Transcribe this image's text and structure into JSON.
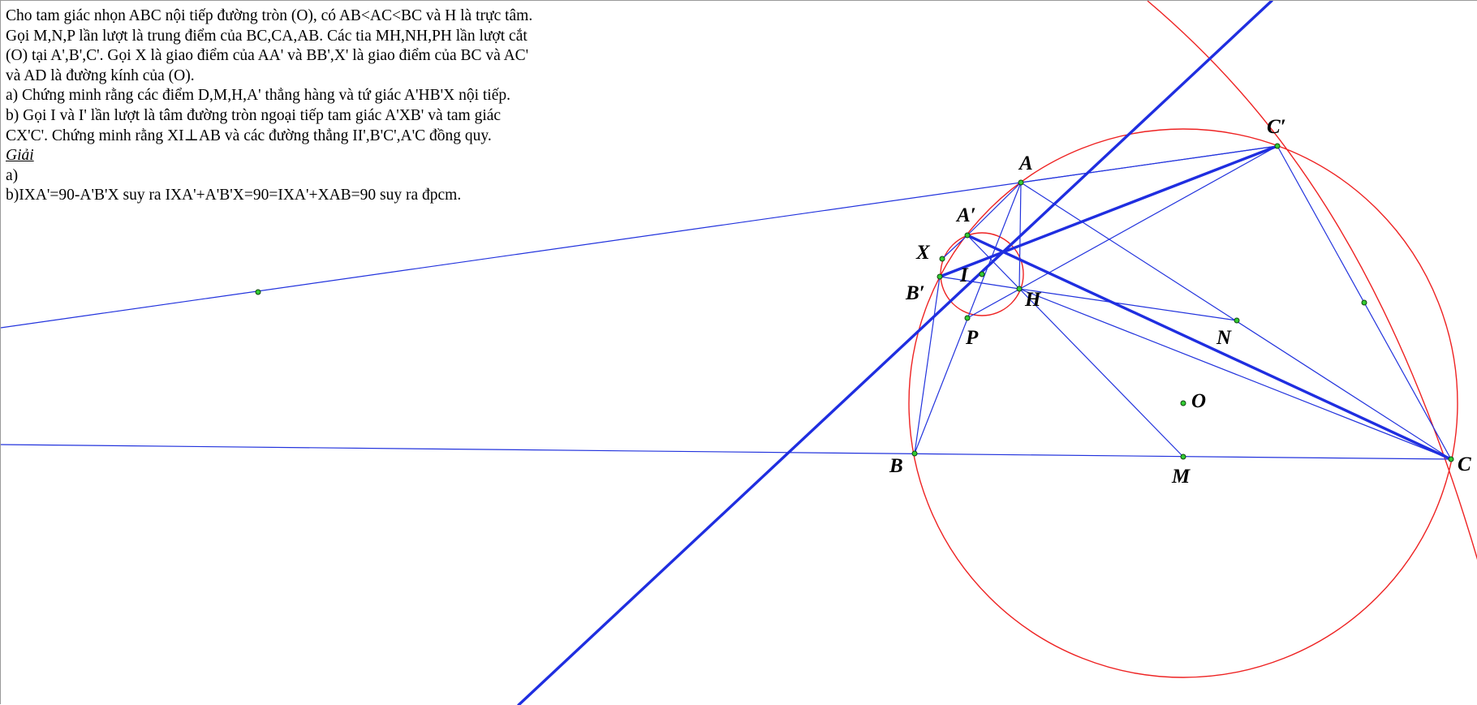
{
  "problem": {
    "lines": [
      "Cho tam giác nhọn ABC nội tiếp đường tròn (O), có AB<AC<BC và H là trực tâm.",
      "Gọi M,N,P lần lượt là trung điểm của BC,CA,AB. Các tia MH,NH,PH lần lượt cắt",
      "(O) tại A',B',C'. Gọi X là giao điểm của AA' và BB',X' là giao điểm của BC và AC'",
      "và AD là đường kính của (O).",
      "a) Chứng minh rằng các điểm D,M,H,A' thẳng hàng và tứ giác A'HB'X nội tiếp.",
      "b) Gọi I và I' lần lượt là tâm đường tròn ngoại tiếp tam giác A'XB' và tam giác",
      "CX'C'. Chứng minh rằng XI⊥AB và các đường thẳng II',B'C',A'C đồng quy."
    ],
    "solution_heading": "Giải",
    "part_a": "a)",
    "part_b": "b)IXA'=90-A'B'X suy ra IXA'+A'B'X=90=IXA'+XAB=90 suy ra đpcm."
  },
  "figure": {
    "colors": {
      "circle": "#ee2222",
      "line": "#2233dd",
      "point_fill": "#33cc33",
      "point_stroke": "#114411",
      "label": "#000000"
    },
    "labels": {
      "A": "A",
      "A_prime": "A′",
      "X": "X",
      "B_prime": "B′",
      "I": "I",
      "H": "H",
      "P": "P",
      "N": "N",
      "O": "O",
      "B": "B",
      "M": "M",
      "C": "C",
      "C_prime": "C′"
    }
  }
}
